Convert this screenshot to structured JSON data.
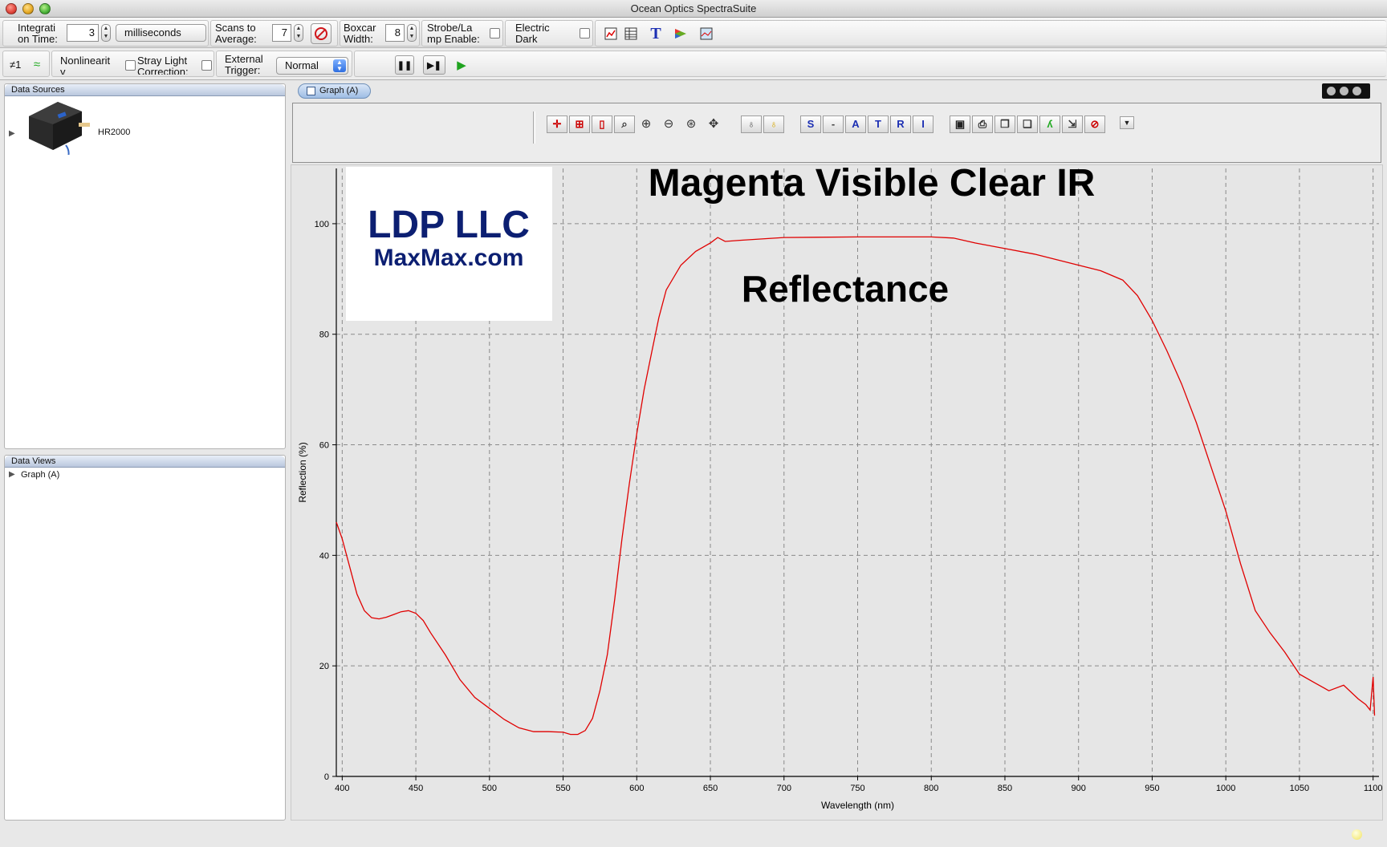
{
  "window": {
    "title": "Ocean Optics SpectraSuite"
  },
  "toolbar1": {
    "integration_label_1": "Integrati",
    "integration_label_2": "on Time:",
    "integration_value": "3",
    "units": "milliseconds",
    "scans_label_1": "Scans to",
    "scans_label_2": "Average:",
    "scans_value": "7",
    "boxcar_label_1": "Boxcar",
    "boxcar_label_2": "Width:",
    "boxcar_value": "8",
    "strobe_label_1": "Strobe/La",
    "strobe_label_2": "mp Enable:",
    "electric_label_1": "Electric",
    "electric_label_2": "Dark"
  },
  "toolbar2": {
    "device_index": "≠1",
    "nonlinearity_label_1": "Nonlinearit",
    "nonlinearity_label_2": "y",
    "stray_label_1": "Stray Light",
    "stray_label_2": "Correction:",
    "trigger_label_1": "External",
    "trigger_label_2": "Trigger:",
    "trigger_value": "Normal"
  },
  "data_sources": {
    "header": "Data Sources",
    "device": "HR2000"
  },
  "data_views": {
    "header": "Data Views",
    "item": "Graph (A)"
  },
  "graph": {
    "tab_label": "Graph (A)",
    "toolbar_letters": [
      "S",
      "-",
      "A",
      "T",
      "R",
      "I"
    ],
    "logo_line1": "LDP LLC",
    "logo_line2": "MaxMax.com",
    "annotation_title": "Magenta Visible Clear IR",
    "annotation_subtitle": "Reflectance"
  },
  "colors": {
    "series": "#e00000",
    "logo_text": "#0c1f72",
    "grid": "#8a8a8a"
  },
  "chart_data": {
    "type": "line",
    "xlabel": "Wavelength (nm)",
    "ylabel": "Reflection (%)",
    "xlim": [
      396,
      1104
    ],
    "ylim": [
      0,
      110
    ],
    "x_ticks": [
      400,
      450,
      500,
      550,
      600,
      650,
      700,
      750,
      800,
      850,
      900,
      950,
      1000,
      1050,
      1100
    ],
    "y_ticks": [
      0,
      20,
      40,
      60,
      80,
      100
    ],
    "grid": true,
    "series": [
      {
        "x": [
          396,
          400,
          405,
          410,
          415,
          420,
          425,
          430,
          435,
          440,
          445,
          450,
          455,
          460,
          470,
          480,
          490,
          500,
          510,
          520,
          530,
          540,
          550,
          555,
          560,
          565,
          570,
          575,
          580,
          585,
          590,
          595,
          600,
          605,
          610,
          615,
          620,
          630,
          640,
          650,
          655,
          660,
          670,
          700,
          750,
          800,
          815,
          830,
          850,
          870,
          900,
          915,
          930,
          940,
          950,
          960,
          970,
          980,
          990,
          1000,
          1010,
          1020,
          1030,
          1040,
          1050,
          1060,
          1070,
          1080,
          1090,
          1095,
          1098,
          1100,
          1101
        ],
        "y": [
          46,
          43,
          38,
          33,
          30,
          28.7,
          28.5,
          28.8,
          29.3,
          29.8,
          30,
          29.5,
          28.2,
          26,
          22,
          17.5,
          14.3,
          12.3,
          10.3,
          8.8,
          8.1,
          8.1,
          8.0,
          7.6,
          7.6,
          8.3,
          10.5,
          15.5,
          22,
          32,
          43,
          53,
          62,
          70,
          76.5,
          83,
          88,
          92.5,
          95,
          96.5,
          97.5,
          96.8,
          97,
          97.5,
          97.6,
          97.6,
          97.4,
          96.5,
          95.5,
          94.5,
          92.5,
          91.5,
          89.8,
          87,
          82.5,
          77,
          71,
          64,
          56,
          48,
          38.5,
          30,
          26,
          22.5,
          18.5,
          17,
          15.5,
          16.5,
          14,
          13,
          12,
          18,
          11
        ]
      }
    ]
  }
}
